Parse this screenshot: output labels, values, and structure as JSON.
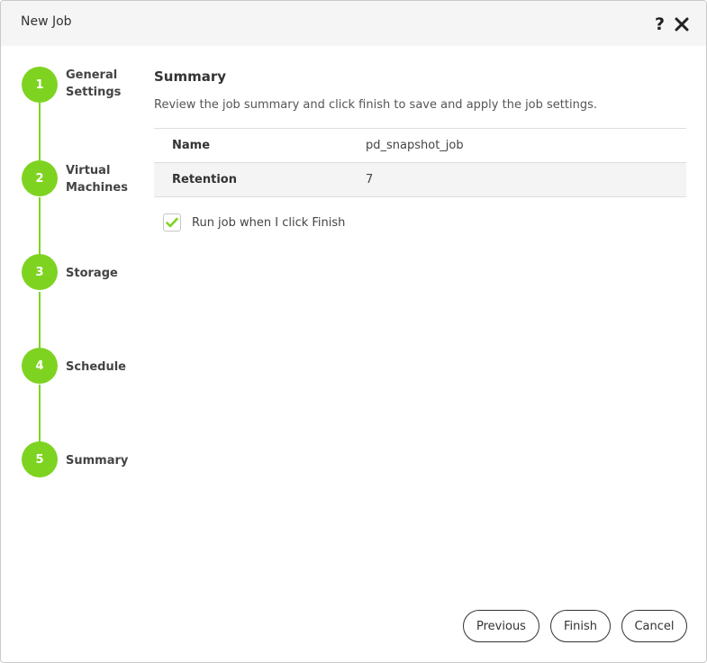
{
  "dialog": {
    "title": "New Job",
    "help_glyph": "?",
    "icons": {
      "help": "question-mark-icon",
      "close": "close-icon"
    }
  },
  "steps": [
    {
      "number": "1",
      "label_line1": "General",
      "label_line2": "Settings"
    },
    {
      "number": "2",
      "label_line1": "Virtual",
      "label_line2": "Machines"
    },
    {
      "number": "3",
      "label_line1": "Storage",
      "label_line2": ""
    },
    {
      "number": "4",
      "label_line1": "Schedule",
      "label_line2": ""
    },
    {
      "number": "5",
      "label_line1": "Summary",
      "label_line2": ""
    }
  ],
  "summary": {
    "title": "Summary",
    "description": "Review the job summary and click finish to save and apply the job settings.",
    "rows": [
      {
        "key": "Name",
        "value": "pd_snapshot_job"
      },
      {
        "key": "Retention",
        "value": "7"
      }
    ],
    "run_checkbox": {
      "label": "Run job when I click Finish",
      "checked": true
    }
  },
  "buttons": {
    "previous": "Previous",
    "finish": "Finish",
    "cancel": "Cancel"
  },
  "colors": {
    "accent": "#7ed321",
    "header_bg": "#f5f5f5",
    "row_alt_bg": "#f4f4f4"
  }
}
